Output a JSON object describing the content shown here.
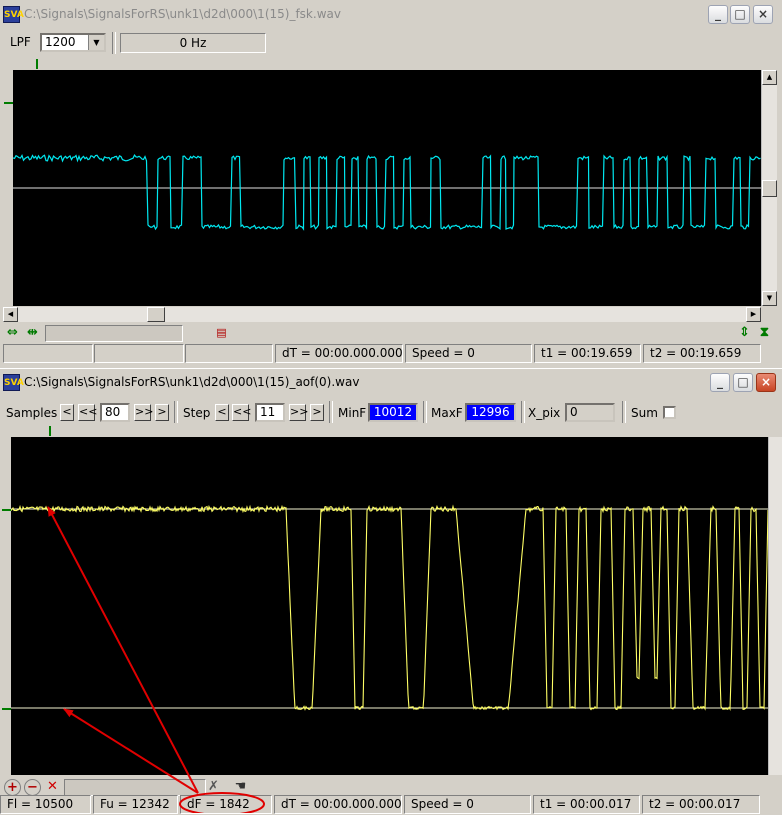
{
  "window1": {
    "title": "C:\\Signals\\SignalsForRS\\unk1\\d2d\\000\\1(15)_fsk.wav",
    "lpf_label": "LPF",
    "lpf_value": "1200",
    "freq_readout": "0 Hz",
    "status": {
      "dT": "dT = 00:00.000.000",
      "speed": "Speed = 0",
      "t1": "t1 = 00:19.659",
      "t2": "t2 = 00:19.659"
    },
    "trace_color": "#00e8f0"
  },
  "window2": {
    "title": "C:\\Signals\\SignalsForRS\\unk1\\d2d\\000\\1(15)_aof(0).wav",
    "samples_label": "Samples",
    "samples_value": "80",
    "step_label": "Step",
    "step_value": "11",
    "minf_label": "MinF",
    "minf_value": "10012",
    "maxf_label": "MaxF",
    "maxf_value": "12996",
    "xpix_label": "X_pix",
    "xpix_value": "0",
    "sum_label": "Sum",
    "nav": {
      "prev": "<",
      "fast_prev": "<<",
      "fast_next": ">>",
      "next": ">"
    },
    "status": {
      "fl": "Fl = 10500",
      "fu": "Fu = 12342",
      "df": "dF = 1842",
      "dT": "dT = 00:00.000.000",
      "speed": "Speed = 0",
      "t1": "t1 = 00:00.017",
      "t2": "t2 = 00:00.017"
    },
    "trace_color": "#ffff66"
  },
  "titlebar_buttons": {
    "minimize": "_",
    "maximize": "□",
    "close": "×"
  },
  "app_icon_text": "SVA",
  "annotation_color": "#e00000"
}
